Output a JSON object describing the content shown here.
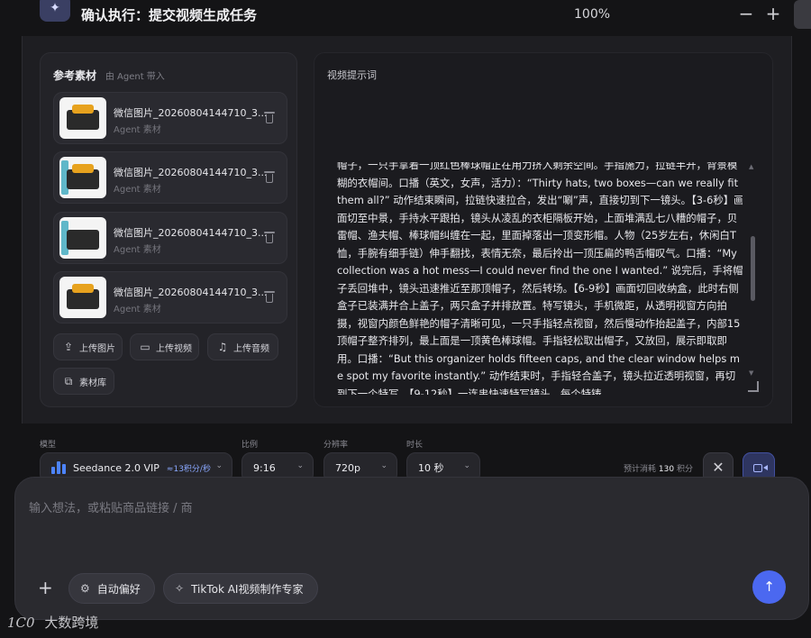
{
  "header": {
    "logo_icon": "sparkle-icon",
    "title": "确认执行：提交视频生成任务",
    "zoom": "100%",
    "zoom_out": "−",
    "zoom_in": "+"
  },
  "references": {
    "title": "参考素材",
    "subtitle": "由 Agent 带入",
    "items": [
      {
        "name": "微信图片_20260804144710_3...",
        "tag": "Agent 素材"
      },
      {
        "name": "微信图片_20260804144710_3...",
        "tag": "Agent 素材"
      },
      {
        "name": "微信图片_20260804144710_3...",
        "tag": "Agent 素材"
      },
      {
        "name": "微信图片_20260804144710_3...",
        "tag": "Agent 素材"
      }
    ],
    "actions": {
      "upload_image": "上传图片",
      "upload_video": "上传视频",
      "upload_audio": "上传音频",
      "library": "素材库"
    }
  },
  "prompt": {
    "label": "视频提示词",
    "text": "帽子，一只手拿着一顶红色棒球帽正在用力挤入剩余空间。手指施力，拉链半开，背景模糊的衣帽间。口播（英文，女声，活力）：“Thirty hats, two boxes—can we really fit them all?” 动作结束瞬间，拉链快速拉合，发出“唰”声，直接切到下一镜头。【3-6秒】画面切至中景，手持水平跟拍，镜头从凌乱的衣柜隔板开始，上面堆满乱七八糟的帽子，贝雷帽、渔夫帽、棒球帽纠缠在一起，里面掉落出一顶变形帽。人物（25岁左右，休闲白T恤，手腕有细手链）伸手翻找，表情无奈，最后拎出一顶压扁的鸭舌帽叹气。口播：“My collection was a hot mess—I could never find the one I wanted.” 说完后，手将帽子丢回堆中，镜头迅速推近至那顶帽子，然后转场。【6-9秒】画面切回收纳盒，此时右侧盒子已装满并合上盖子，两只盒子并排放置。特写镜头，手机微距，从透明视窗方向拍摄，视窗内颜色鲜艳的帽子清晰可见，一只手指轻点视窗，然后慢动作抬起盖子，内部15顶帽子整齐排列，最上面是一顶黄色棒球帽。手指轻松取出帽子，又放回，展示即取即用。口播：“But this organizer holds fifteen caps, and the clear window helps me spot my favorite instantly.” 动作结束时，手指轻合盖子，镜头拉近透明视窗，再切到下一个特写。【9-12秒】一连串快速特写镜头，每个特铸"
  },
  "settings": {
    "model_label": "模型",
    "model": "Seedance 2.0 VIP",
    "model_rate": "≈13积分/秒",
    "ratio_label": "比例",
    "ratio": "9:16",
    "resolution_label": "分辨率",
    "resolution": "720p",
    "duration_label": "时长",
    "duration": "10 秒",
    "cost_prefix": "预计消耗",
    "cost_value": "130",
    "cost_suffix": "积分"
  },
  "composer": {
    "placeholder": "输入想法，或粘贴商品链接 / 商",
    "preference": "自动偏好",
    "expert": "TikTok AI视频制作专家"
  },
  "watermark": {
    "logo": "1C0",
    "text": "大数跨境"
  },
  "colors": {
    "background": "#141416",
    "panel": "#232328",
    "accent": "#4b68f0",
    "model_bars": "#4d84ff"
  }
}
